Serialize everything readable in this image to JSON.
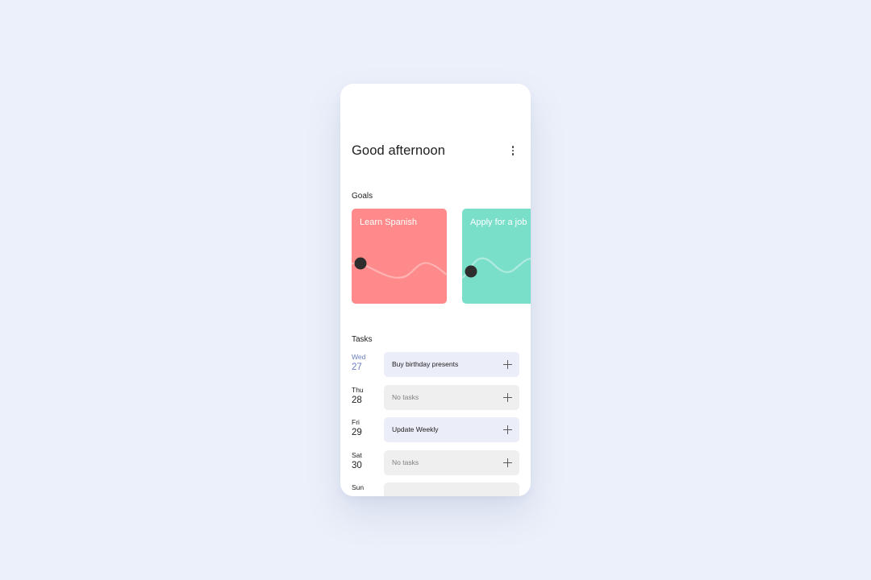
{
  "header": {
    "greeting": "Good afternoon",
    "menu_icon": "more-vertical-icon"
  },
  "goals": {
    "section_label": "Goals",
    "items": [
      {
        "title": "Learn Spanish",
        "color": "#FF8A8B"
      },
      {
        "title": "Apply for a job",
        "color": "#7ADFC9"
      }
    ]
  },
  "tasks": {
    "section_label": "Tasks",
    "days": [
      {
        "day": "Wed",
        "date": "27",
        "task": "Buy birthday presents",
        "today": true
      },
      {
        "day": "Thu",
        "date": "28",
        "task": "No tasks"
      },
      {
        "day": "Fri",
        "date": "29",
        "task": "Update Weekly"
      },
      {
        "day": "Sat",
        "date": "30",
        "task": "No tasks"
      },
      {
        "day": "Sun",
        "date": "",
        "task": ""
      }
    ],
    "add_icon": "plus-icon"
  },
  "colors": {
    "background": "#ECF0FA",
    "accent_today": "#6A7EC0",
    "task_bg": "#EBEDF9",
    "empty_task_bg": "#EFEFF0"
  }
}
